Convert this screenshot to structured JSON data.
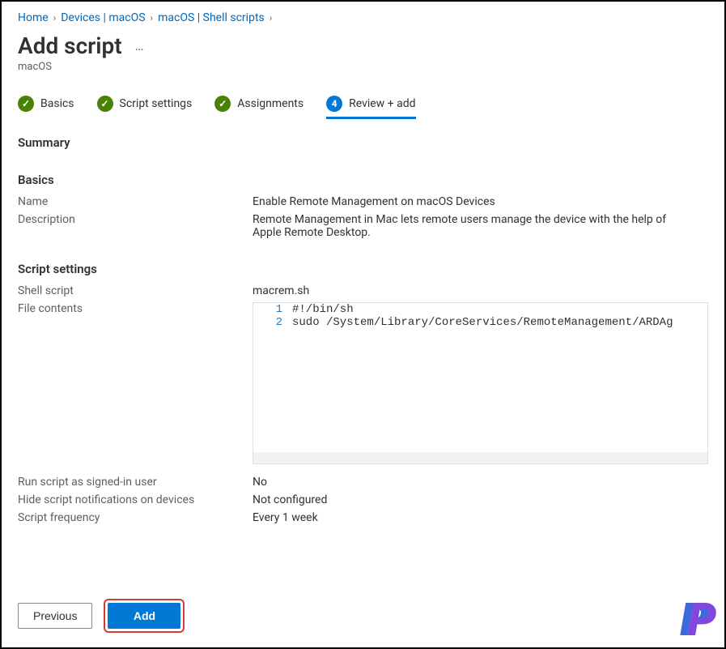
{
  "breadcrumb": {
    "home": "Home",
    "devices": "Devices | macOS",
    "scripts": "macOS | Shell scripts"
  },
  "page": {
    "title": "Add script",
    "subtitle": "macOS"
  },
  "tabs": {
    "basics": "Basics",
    "script_settings": "Script settings",
    "assignments": "Assignments",
    "review": "Review + add"
  },
  "summary": {
    "heading": "Summary"
  },
  "basics": {
    "heading": "Basics",
    "name_label": "Name",
    "name_value": "Enable Remote Management on macOS Devices",
    "description_label": "Description",
    "description_value": "Remote Management in Mac lets remote users manage the device with the help of Apple Remote Desktop."
  },
  "script_settings": {
    "heading": "Script settings",
    "shell_label": "Shell script",
    "shell_value": "macrem.sh",
    "file_contents_label": "File contents",
    "code_lines": [
      "#!/bin/sh",
      "sudo /System/Library/CoreServices/RemoteManagement/ARDAg"
    ],
    "run_as_signed_in_label": "Run script as signed-in user",
    "run_as_signed_in_value": "No",
    "hide_notifications_label": "Hide script notifications on devices",
    "hide_notifications_value": "Not configured",
    "frequency_label": "Script frequency",
    "frequency_value": "Every 1 week"
  },
  "footer": {
    "previous": "Previous",
    "add": "Add"
  },
  "current_step_number": "4"
}
